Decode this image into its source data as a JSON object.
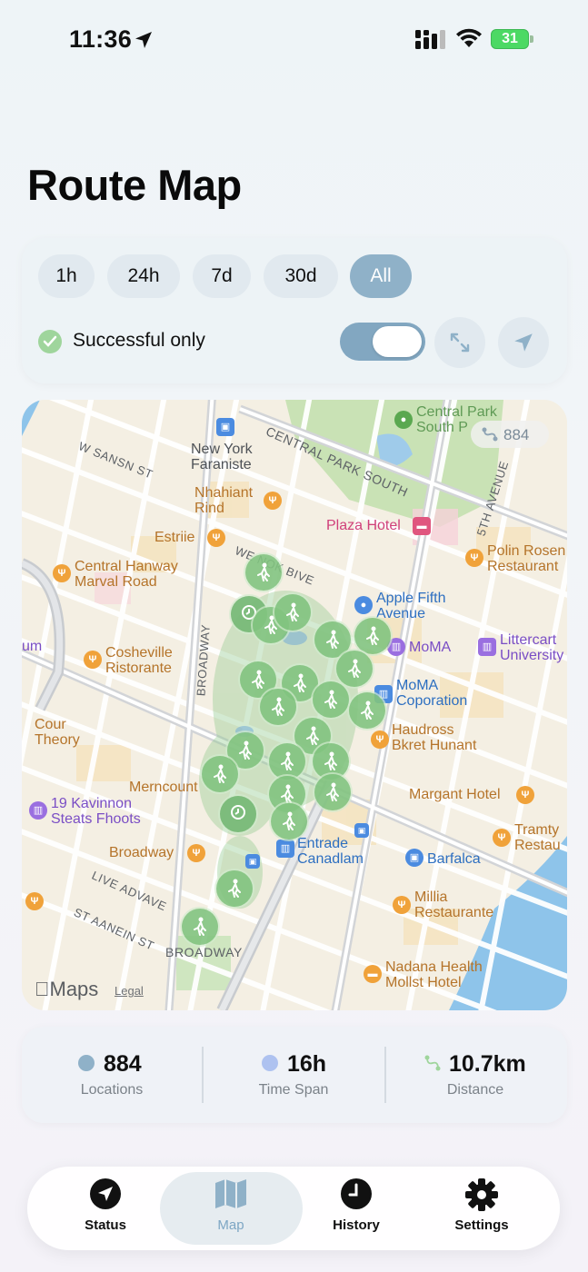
{
  "status_bar": {
    "time": "11:36",
    "battery": "31"
  },
  "page": {
    "title": "Route Map"
  },
  "filters": {
    "ranges": [
      "1h",
      "24h",
      "7d",
      "30d",
      "All"
    ],
    "selected_range": "All",
    "successful_only_label": "Successful only",
    "successful_only_enabled": true
  },
  "map": {
    "cluster_count": "884",
    "brand": "Maps",
    "legal": "Legal",
    "labels": {
      "central_park_south_poi": "Central Park\nSouth P",
      "new_york_faraniste": "New York\nFaraniste",
      "nhahiant_rind": "Nhahiant\nRind",
      "estriie": "Estriie",
      "plaza_hotel": "Plaza Hotel",
      "polin_rosen": "Polin Rosen\nRestaurant",
      "central_hanway": "Central Hanway\nMarval Road",
      "apple_fifth": "Apple Fifth\nAvenue",
      "moma": "MoMA",
      "littercart": "Littercart\nUniversity",
      "um": "um",
      "cosheville": "Cosheville\nRistorante",
      "moma_coporation": "MoMA\nCoporation",
      "cour_theory": "Cour\nTheory",
      "haudross": "Haudross\nBkret Hunant",
      "merncount": "Merncount",
      "kavinnon": "19 Kavinnon\nSteats Fhoots",
      "margant_hotel": "Margant Hotel",
      "tramty": "Tramty\nRestau",
      "broadway_poi": "Broadway",
      "entrade": "Entrade\nCanadlam",
      "barfalca": "Barfalca",
      "millia": "Millia\nRestaurante",
      "nadana": "Nadana Health\nMollst Hotel",
      "broadway_bottom": "BROADWAY"
    },
    "streets": {
      "w_sansn": "W SANSN ST",
      "central_park_south": "CENTRAL PARK SOUTH",
      "fifth_avenue": "5TH AVENUE",
      "we_nok": "WE NOK BIVE",
      "broadway_vertical": "BROADWAY",
      "live_advave": "LIVE ADVAVE",
      "st_aanein": "ST AANEIN ST"
    }
  },
  "stats": {
    "locations_value": "884",
    "locations_label": "Locations",
    "time_span_value": "16h",
    "time_span_label": "Time Span",
    "distance_value": "10.7km",
    "distance_label": "Distance"
  },
  "tabs": [
    {
      "label": "Status",
      "icon": "location-arrow-icon"
    },
    {
      "label": "Map",
      "icon": "map-icon",
      "active": true
    },
    {
      "label": "History",
      "icon": "clock-icon"
    },
    {
      "label": "Settings",
      "icon": "gear-icon"
    }
  ],
  "colors": {
    "accent": "#8fb1c8",
    "route_green": "#82c380",
    "tab_active": "#7da6c4"
  }
}
